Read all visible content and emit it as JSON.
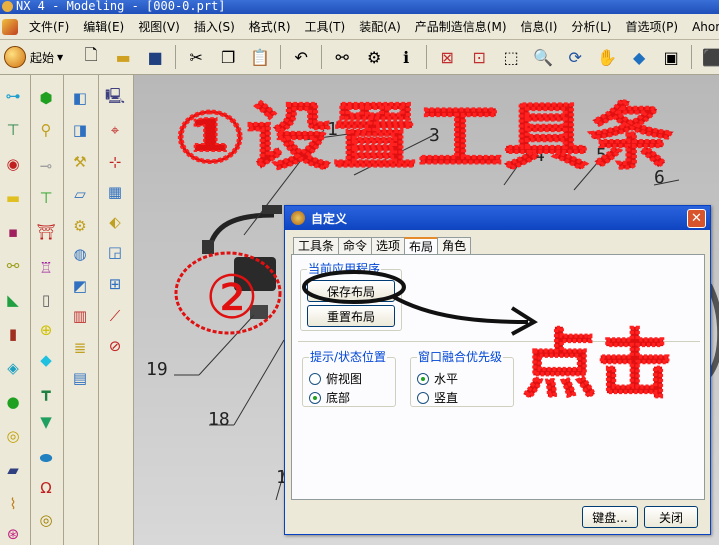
{
  "window": {
    "title": "NX 4 - Modeling - [000-0.prt]"
  },
  "menu": [
    "文件(F)",
    "编辑(E)",
    "视图(V)",
    "插入(S)",
    "格式(R)",
    "工具(T)",
    "装配(A)",
    "产品制造信息(M)",
    "信息(I)",
    "分析(L)",
    "首选项(P)",
    "Ahong"
  ],
  "toolbar": {
    "start_label": "起始"
  },
  "viewport": {
    "callouts": [
      "1",
      "3",
      "4",
      "5",
      "6",
      "19",
      "18",
      "1"
    ]
  },
  "dialog": {
    "title": "自定义",
    "tabs": [
      "工具条",
      "命令",
      "选项",
      "布局",
      "角色"
    ],
    "active_tab": "布局",
    "group_app": {
      "label": "当前应用程序",
      "save_btn": "保存布局",
      "reset_btn": "重置布局"
    },
    "group_prompt": {
      "label": "提示/状态位置",
      "options": [
        "俯视图",
        "底部"
      ],
      "selected": "底部"
    },
    "group_merge": {
      "label": "窗口融合优先级",
      "options": [
        "水平",
        "竖直"
      ],
      "selected": "水平"
    },
    "keyboard_btn": "键盘...",
    "close_btn": "关闭"
  },
  "annotations": {
    "heading": "①设置工具条",
    "circled_number": "②",
    "click_note": "点击"
  },
  "colors": {
    "title_blue": "#1f4fb8",
    "annotation_red": "#e01010",
    "tab_accent": "#e68b2c"
  }
}
